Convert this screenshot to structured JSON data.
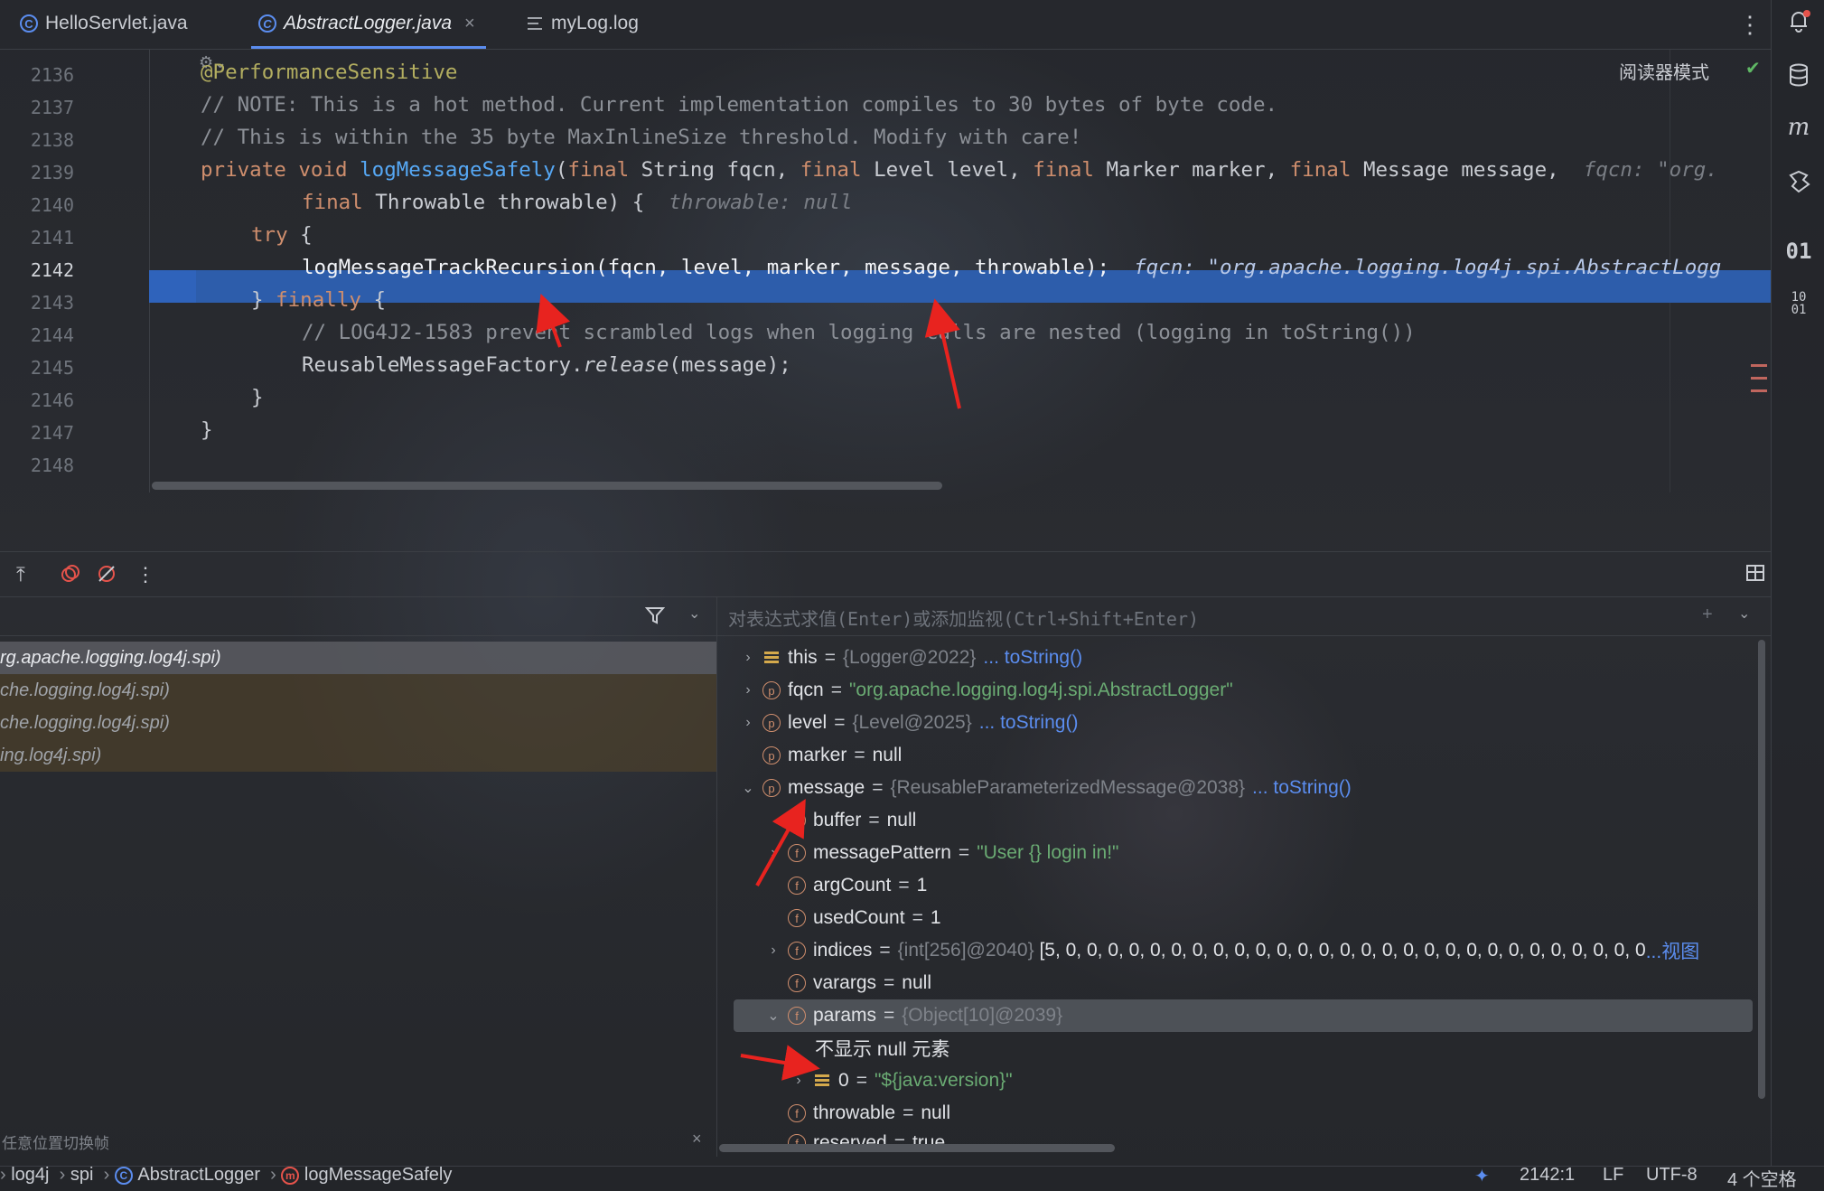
{
  "tabs": [
    {
      "label": "HelloServlet.java",
      "icon": "class-icon"
    },
    {
      "label": "AbstractLogger.java",
      "icon": "class-icon",
      "active": true
    },
    {
      "label": "myLog.log",
      "icon": "text-file-icon"
    }
  ],
  "editor": {
    "reader_mode": "阅读器模式",
    "line_numbers": [
      "2136",
      "2137",
      "2138",
      "2139",
      "2140",
      "2141",
      "2142",
      "2143",
      "2144",
      "2145",
      "2146",
      "2147",
      "2148"
    ],
    "current_line": "2142",
    "lines": {
      "l2136": "@PerformanceSensitive",
      "l2137": "// NOTE: This is a hot method. Current implementation compiles to 30 bytes of byte code.",
      "l2138": "// This is within the 35 byte MaxInlineSize threshold. Modify with care!",
      "l2139_kw1": "private void ",
      "l2139_fn": "logMessageSafely",
      "l2139_a": "(",
      "l2139_k1": "final",
      "l2139_b": " String fqcn, ",
      "l2139_k2": "final",
      "l2139_c": " Level level, ",
      "l2139_k3": "final",
      "l2139_d": " Marker marker, ",
      "l2139_k4": "final",
      "l2139_e": " Message message,",
      "l2139_hint": "fqcn: \"org.",
      "l2140_kw": "final",
      "l2140_a": " Throwable throwable) {",
      "l2140_hint": "throwable: null",
      "l2141_kw": "try",
      "l2141_a": " {",
      "l2142": "logMessageTrackRecursion(fqcn, level, marker, message, throwable);",
      "l2142_hint": "fqcn: \"org.apache.logging.log4j.spi.AbstractLogg",
      "l2143_a": "} ",
      "l2143_kw": "finally",
      "l2143_b": " {",
      "l2144": "// LOG4J2-1583 prevent scrambled logs when logging calls are nested (logging in toString())",
      "l2145_a": "ReusableMessageFactory.",
      "l2145_it": "release",
      "l2145_b": "(message);",
      "l2146": "}",
      "l2147": "}"
    }
  },
  "frames": [
    {
      "label": "rg.apache.logging.log4j.spi)",
      "selected": true
    },
    {
      "label": "che.logging.log4j.spi)"
    },
    {
      "label": "che.logging.log4j.spi)"
    },
    {
      "label": "ing.log4j.spi)"
    }
  ],
  "frames_tip": "任意位置切换帧",
  "eval_placeholder": "对表达式求值(Enter)或添加监视(Ctrl+Shift+Enter)",
  "variables": {
    "this": {
      "name": "this",
      "type": "{Logger@2022}",
      "link": "... toString()"
    },
    "fqcn": {
      "name": "fqcn",
      "value": "\"org.apache.logging.log4j.spi.AbstractLogger\""
    },
    "level": {
      "name": "level",
      "type": "{Level@2025}",
      "link": "... toString()"
    },
    "marker": {
      "name": "marker",
      "value": "null"
    },
    "message": {
      "name": "message",
      "type": "{ReusableParameterizedMessage@2038}",
      "link": "... toString()"
    },
    "buffer": {
      "name": "buffer",
      "value": "null"
    },
    "messagePattern": {
      "name": "messagePattern",
      "value": "\"User {} login in!\""
    },
    "argCount": {
      "name": "argCount",
      "value": "1"
    },
    "usedCount": {
      "name": "usedCount",
      "value": "1"
    },
    "indices": {
      "name": "indices",
      "type": "{int[256]@2040}",
      "value": "[5, 0, 0, 0, 0, 0, 0, 0, 0, 0, 0, 0, 0, 0, 0, 0, 0, 0, 0, 0, 0, 0, 0, 0, 0, 0, 0, 0, 0",
      "link": "...视图"
    },
    "varargs": {
      "name": "varargs",
      "value": "null"
    },
    "params": {
      "name": "params",
      "type": "{Object[10]@2039}"
    },
    "null_note": "不显示 null 元素",
    "p0": {
      "name": "0",
      "value": "\"${java:version}\""
    },
    "throwable": {
      "name": "throwable",
      "value": "null"
    },
    "reserved": {
      "name": "reserved",
      "value": "true"
    }
  },
  "status": {
    "crumbs": [
      "log4j",
      "spi",
      "AbstractLogger",
      "logMessageSafely"
    ],
    "position": "2142:1",
    "line_sep": "LF",
    "encoding": "UTF-8",
    "indent": "4 个空格"
  },
  "colors": {
    "accent": "#5b8def",
    "keyword": "#cf8e6d",
    "string": "#6aab73",
    "highlight": "#2d5dab"
  }
}
